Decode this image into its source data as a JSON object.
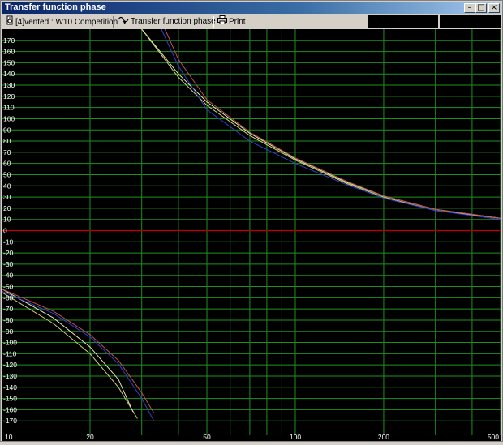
{
  "window": {
    "title": "Transfer function phase"
  },
  "toolbar": {
    "enclosure_label": "[4]vented : W10 Competition",
    "view_label": "Transfer function phase",
    "print_label": "Print"
  },
  "colors": {
    "background": "#000000",
    "grid": "#1f8f1f",
    "zero_line": "#c00000",
    "label": "#ffffff"
  },
  "chart_data": {
    "type": "line",
    "title": "",
    "xlabel": "",
    "ylabel": "",
    "x_scale": "log",
    "xlim": [
      10,
      500
    ],
    "ylim": [
      -180,
      180
    ],
    "x_ticks": [
      10,
      20,
      50,
      100,
      200,
      500
    ],
    "y_ticks": [
      170,
      160,
      150,
      140,
      130,
      120,
      110,
      100,
      90,
      80,
      70,
      60,
      50,
      40,
      30,
      20,
      10,
      0,
      -10,
      -20,
      -30,
      -40,
      -50,
      -60,
      -70,
      -80,
      -90,
      -100,
      -110,
      -120,
      -130,
      -140,
      -150,
      -160,
      -170
    ],
    "grid": true,
    "series": [
      {
        "color": "#d0d070",
        "x": [
          10,
          15,
          20,
          25,
          29,
          30,
          40,
          50,
          70,
          100,
          150,
          200,
          300,
          500
        ],
        "y": [
          -55,
          -83,
          -110,
          -140,
          -168,
          180,
          137,
          112,
          85,
          63,
          42,
          30,
          18,
          11
        ]
      },
      {
        "color": "#e8e8b0",
        "x": [
          10,
          15,
          20,
          25,
          28,
          30,
          40,
          50,
          70,
          100,
          150,
          200,
          300,
          500
        ],
        "y": [
          -52,
          -78,
          -104,
          -133,
          -162,
          180,
          140,
          115,
          87,
          64,
          43,
          31,
          19,
          11
        ]
      },
      {
        "color": "#c05050",
        "x": [
          10,
          15,
          20,
          25,
          30,
          33,
          36,
          40,
          50,
          70,
          100,
          150,
          200,
          300,
          500
        ],
        "y": [
          -52,
          -72,
          -93,
          -116,
          -145,
          -163,
          180,
          153,
          117,
          88,
          65,
          44,
          31,
          19,
          11
        ]
      },
      {
        "color": "#3040d0",
        "x": [
          10,
          15,
          20,
          25,
          30,
          33,
          35,
          40,
          50,
          70,
          100,
          150,
          200,
          300,
          500
        ],
        "y": [
          -54,
          -74,
          -95,
          -119,
          -150,
          -170,
          180,
          147,
          108,
          80,
          60,
          41,
          29,
          18,
          10
        ]
      }
    ]
  }
}
